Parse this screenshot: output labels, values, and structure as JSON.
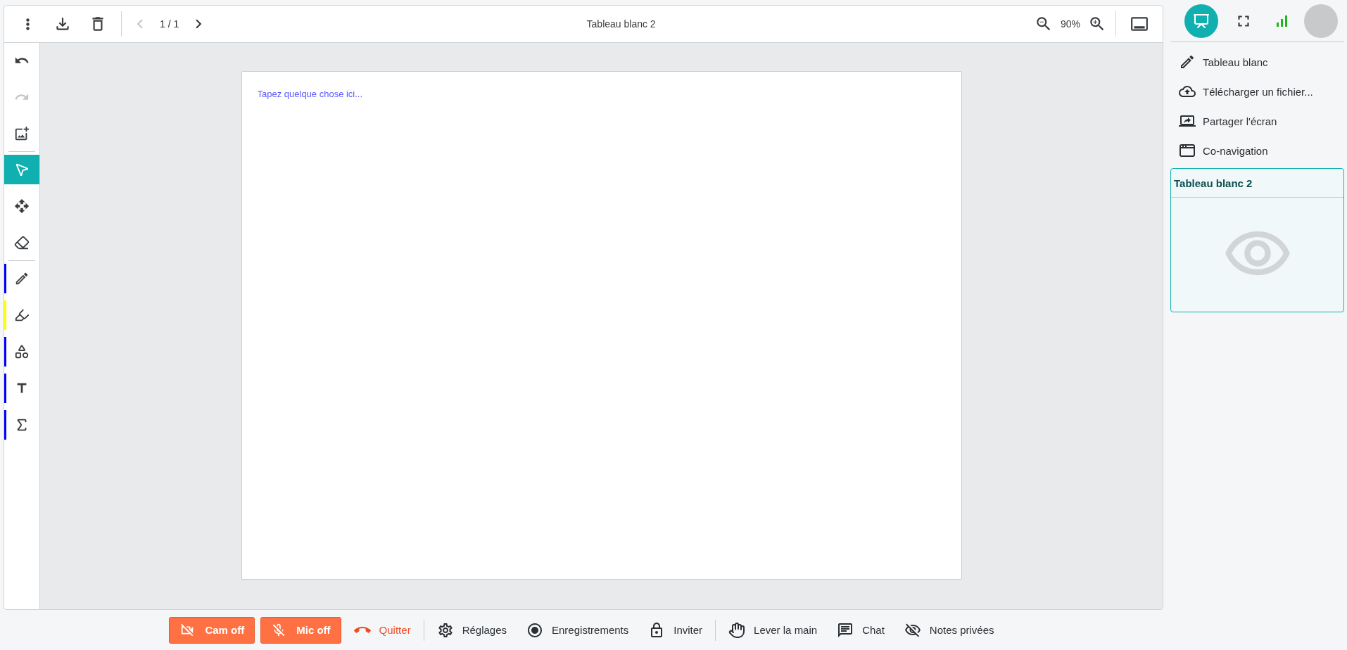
{
  "top_bar": {
    "page": "1 / 1",
    "title": "Tableau blanc 2",
    "zoom": "90%"
  },
  "tool_groups": [
    [
      {
        "kind": "undo",
        "disabled": false,
        "selected": false
      },
      {
        "kind": "redo",
        "disabled": true,
        "selected": false
      },
      {
        "kind": "image",
        "disabled": false,
        "selected": false
      }
    ],
    [
      {
        "kind": "select",
        "disabled": false,
        "selected": true
      },
      {
        "kind": "move",
        "disabled": false,
        "selected": false
      },
      {
        "kind": "eraser",
        "disabled": false,
        "selected": false
      }
    ],
    [
      {
        "kind": "pencil",
        "disabled": false,
        "selected": false,
        "color": "#0000ff"
      },
      {
        "kind": "highlighter",
        "disabled": false,
        "selected": false,
        "color": "#ffff00"
      },
      {
        "kind": "shapes",
        "disabled": false,
        "selected": false,
        "color": "#0000ff"
      },
      {
        "kind": "text",
        "disabled": false,
        "selected": false,
        "color": "#0000ff"
      },
      {
        "kind": "formula",
        "disabled": false,
        "selected": false,
        "color": "#0000ff"
      }
    ]
  ],
  "board": {
    "placeholder": "Tapez quelque chose ici..."
  },
  "view_modes": [
    {
      "kind": "present",
      "selected": true
    },
    {
      "kind": "fullscreen",
      "selected": false
    }
  ],
  "menu": [
    {
      "kind": "pencil",
      "label": "Tableau blanc"
    },
    {
      "kind": "upload",
      "label": "Télécharger un fichier..."
    },
    {
      "kind": "share",
      "label": "Partager l'écran"
    },
    {
      "kind": "browse",
      "label": "Co-navigation"
    }
  ],
  "card": {
    "title": "Tableau blanc 2"
  },
  "media": [
    {
      "kind": "camera",
      "label": "Cam off",
      "off": true
    },
    {
      "kind": "microphone",
      "label": "Mic off",
      "off": true
    }
  ],
  "action_groups": [
    [
      {
        "kind": "hangup",
        "label": "Quitter"
      }
    ],
    [
      {
        "kind": "settings",
        "label": "Réglages"
      },
      {
        "kind": "record",
        "label": "Enregistrements"
      },
      {
        "kind": "lock",
        "label": "Inviter"
      }
    ],
    [
      {
        "kind": "hand",
        "label": "Lever la main"
      },
      {
        "kind": "chat",
        "label": "Chat"
      },
      {
        "kind": "notes",
        "label": "Notes privées"
      }
    ]
  ]
}
